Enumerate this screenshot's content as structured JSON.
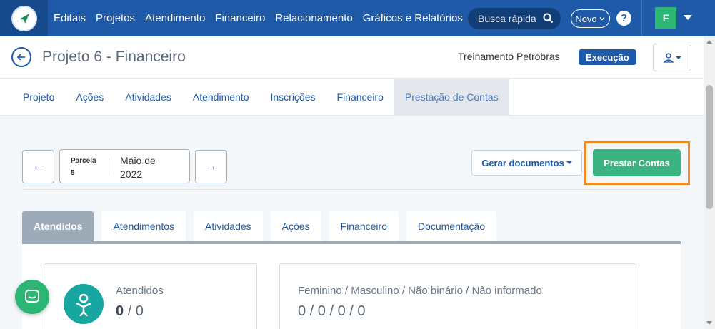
{
  "nav": {
    "items": [
      "Editais",
      "Projetos",
      "Atendimento",
      "Financeiro",
      "Relacionamento",
      "Gráficos e Relatórios"
    ],
    "search_label": "Busca rápida",
    "novo_label": "Novo",
    "help_label": "?",
    "avatar_initial": "F"
  },
  "project": {
    "title": "Projeto 6 - Financeiro",
    "organization": "Treinamento Petrobras",
    "status": "Execução"
  },
  "main_tabs": [
    "Projeto",
    "Ações",
    "Atividades",
    "Atendimento",
    "Inscrições",
    "Financeiro",
    "Prestação de Contas"
  ],
  "main_tabs_active": 6,
  "parcela": {
    "label": "Parcela",
    "number": "5",
    "month": "Maio de 2022",
    "prev_label": "←",
    "next_label": "→"
  },
  "actions": {
    "gerar_label": "Gerar documentos",
    "prestar_label": "Prestar Contas"
  },
  "sub_tabs": [
    "Atendidos",
    "Atendimentos",
    "Atividades",
    "Ações",
    "Financeiro",
    "Documentação"
  ],
  "sub_tabs_active": 0,
  "cards": {
    "atendidos_label": "Atendidos",
    "atendidos_value": "0",
    "atendidos_total": "/ 0",
    "gender_label": "Feminino / Masculino / Não binário / Não informado",
    "gender_value": "0 / 0 / 0 / 0"
  },
  "colors": {
    "brand": "#1f5aa8",
    "success": "#3cb482",
    "highlight": "#f08a24",
    "teal": "#18a6a0"
  }
}
